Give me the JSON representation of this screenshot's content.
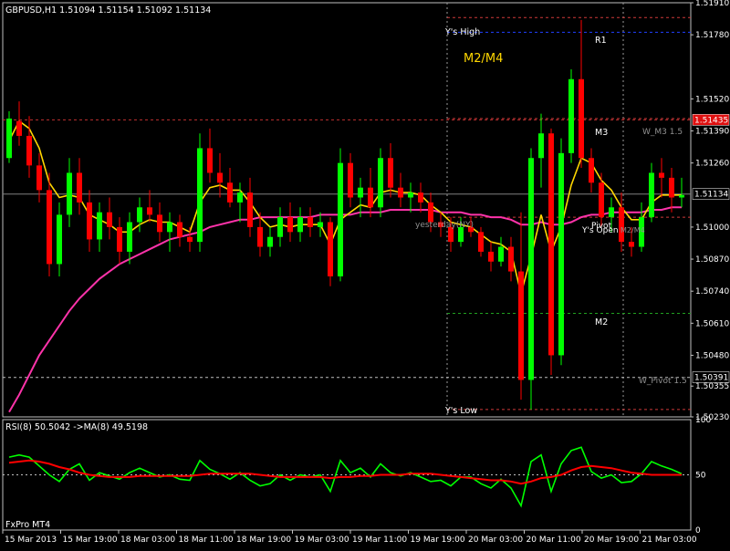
{
  "header": {
    "symbol_info": "GBPUSD,H1  1.51094 1.51154 1.51092 1.51134"
  },
  "footer": {
    "broker": "FxPro MT4"
  },
  "chart_data": [
    {
      "type": "candlestick",
      "ylim": [
        1.5023,
        1.5191
      ],
      "y_ticks": [
        "1.51910",
        "1.51780",
        "1.51520",
        "1.51390",
        "1.51260",
        "1.51000",
        "1.50870",
        "1.50740",
        "1.50610",
        "1.50480",
        "1.50355",
        "1.50230"
      ],
      "x_tick_labels": [
        "15 Mar 2013",
        "15 Mar 19:00",
        "18 Mar 03:00",
        "18 Mar 11:00",
        "18 Mar 19:00",
        "19 Mar 03:00",
        "19 Mar 11:00",
        "19 Mar 19:00",
        "20 Mar 03:00",
        "20 Mar 11:00",
        "20 Mar 19:00",
        "21 Mar 03:00"
      ],
      "price_tags": [
        {
          "value": "1.51435",
          "level": 1.51435,
          "color": "#e01010",
          "text_color": "#ffffff"
        },
        {
          "value": "1.51134",
          "level": 1.51134,
          "color": "#000000",
          "text_color": "#ffffff"
        },
        {
          "value": "1.50391",
          "level": 1.50391,
          "color": "#000000",
          "text_color": "#ffffff"
        }
      ],
      "levels": [
        {
          "label": "Y's High",
          "level": 1.5185,
          "color": "#d03a3a",
          "style": "dashed"
        },
        {
          "label": "R1",
          "level": 1.5179,
          "color": "#2040ff",
          "style": "dashed"
        },
        {
          "label": "M3",
          "level": 1.5144,
          "color": "#d03a3a",
          "style": "dashed"
        },
        {
          "label": "Pivot",
          "level": 1.5104,
          "color": "#d03a3a",
          "style": "dashed"
        },
        {
          "label": "M2",
          "level": 1.5065,
          "color": "#20a020",
          "style": "dashed"
        },
        {
          "label": "W_Pivot",
          "level": 1.5039,
          "color": "#c0c0c0",
          "style": "dashed"
        },
        {
          "label": "Y's Low",
          "level": 1.5026,
          "color": "#d03a3a",
          "style": "dashed"
        }
      ],
      "annotations": [
        {
          "text": "Y's High",
          "color": "#ffffff"
        },
        {
          "text": "M2/M4",
          "color": "#ffd700"
        },
        {
          "text": "R1",
          "color": "#ffffff"
        },
        {
          "text": "M3",
          "color": "#ffffff"
        },
        {
          "text": "W_M3 1.5",
          "color": "#909090"
        },
        {
          "text": "yesterday(NY)",
          "color": "#909090"
        },
        {
          "text": "Pivot",
          "color": "#ffffff"
        },
        {
          "text": "Y's Open",
          "color": "#ffffff"
        },
        {
          "text": "M2/M4",
          "color": "#909090"
        },
        {
          "text": "M2",
          "color": "#ffffff"
        },
        {
          "text": "W_Pivot 1.5",
          "color": "#909090"
        },
        {
          "text": "Y's Low",
          "color": "#ffffff"
        }
      ],
      "colors": {
        "bull": "#00ff00",
        "bear": "#ff0000",
        "ma_fast": "#ffd700",
        "ma_slow": "#ff33aa"
      },
      "series": [
        {
          "name": "candles",
          "candles": [
            [
              1.5128,
              1.5147,
              1.5126,
              1.5144
            ],
            [
              1.5143,
              1.5151,
              1.5133,
              1.5137
            ],
            [
              1.5137,
              1.5145,
              1.512,
              1.5125
            ],
            [
              1.5125,
              1.513,
              1.511,
              1.5115
            ],
            [
              1.5115,
              1.5122,
              1.508,
              1.5085
            ],
            [
              1.5085,
              1.511,
              1.508,
              1.5105
            ],
            [
              1.5105,
              1.5128,
              1.51,
              1.5122
            ],
            [
              1.5122,
              1.5128,
              1.5105,
              1.511
            ],
            [
              1.511,
              1.5115,
              1.509,
              1.5095
            ],
            [
              1.5095,
              1.511,
              1.509,
              1.5106
            ],
            [
              1.5106,
              1.5112,
              1.5095,
              1.51
            ],
            [
              1.51,
              1.5104,
              1.5085,
              1.509
            ],
            [
              1.509,
              1.5106,
              1.5085,
              1.5102
            ],
            [
              1.5102,
              1.5112,
              1.5098,
              1.5108
            ],
            [
              1.5108,
              1.5115,
              1.5102,
              1.5105
            ],
            [
              1.5105,
              1.511,
              1.5094,
              1.5098
            ],
            [
              1.5098,
              1.5106,
              1.509,
              1.5102
            ],
            [
              1.5102,
              1.5105,
              1.5092,
              1.5096
            ],
            [
              1.5096,
              1.51,
              1.509,
              1.5094
            ],
            [
              1.5094,
              1.5138,
              1.509,
              1.5132
            ],
            [
              1.5132,
              1.514,
              1.5118,
              1.5122
            ],
            [
              1.5122,
              1.513,
              1.5112,
              1.5118
            ],
            [
              1.5118,
              1.5124,
              1.5108,
              1.511
            ],
            [
              1.511,
              1.5118,
              1.5102,
              1.5114
            ],
            [
              1.5114,
              1.512,
              1.5096,
              1.51
            ],
            [
              1.51,
              1.5106,
              1.5088,
              1.5092
            ],
            [
              1.5092,
              1.51,
              1.5088,
              1.5096
            ],
            [
              1.5096,
              1.5108,
              1.5092,
              1.5104
            ],
            [
              1.5104,
              1.511,
              1.5094,
              1.5098
            ],
            [
              1.5098,
              1.5108,
              1.5094,
              1.5104
            ],
            [
              1.5104,
              1.5108,
              1.5096,
              1.51
            ],
            [
              1.51,
              1.5106,
              1.5096,
              1.5102
            ],
            [
              1.5102,
              1.5104,
              1.5076,
              1.508
            ],
            [
              1.508,
              1.5132,
              1.5078,
              1.5126
            ],
            [
              1.5126,
              1.513,
              1.5108,
              1.5112
            ],
            [
              1.5112,
              1.512,
              1.5104,
              1.5116
            ],
            [
              1.5116,
              1.5124,
              1.5104,
              1.5108
            ],
            [
              1.5108,
              1.5132,
              1.5104,
              1.5128
            ],
            [
              1.5128,
              1.5134,
              1.5112,
              1.5116
            ],
            [
              1.5116,
              1.5122,
              1.5108,
              1.5112
            ],
            [
              1.5112,
              1.5118,
              1.5106,
              1.5114
            ],
            [
              1.5114,
              1.5118,
              1.5106,
              1.511
            ],
            [
              1.511,
              1.5114,
              1.5098,
              1.5102
            ],
            [
              1.5102,
              1.5106,
              1.5096,
              1.51
            ],
            [
              1.51,
              1.5104,
              1.509,
              1.5094
            ],
            [
              1.5094,
              1.5104,
              1.5092,
              1.51
            ],
            [
              1.51,
              1.5104,
              1.5096,
              1.5098
            ],
            [
              1.5098,
              1.51,
              1.5088,
              1.509
            ],
            [
              1.509,
              1.5094,
              1.5082,
              1.5086
            ],
            [
              1.5086,
              1.5096,
              1.5084,
              1.5092
            ],
            [
              1.5092,
              1.5096,
              1.5078,
              1.5082
            ],
            [
              1.5082,
              1.5106,
              1.503,
              1.5038
            ],
            [
              1.5038,
              1.5132,
              1.5026,
              1.5128
            ],
            [
              1.5128,
              1.5146,
              1.5116,
              1.5138
            ],
            [
              1.5138,
              1.514,
              1.504,
              1.5048
            ],
            [
              1.5048,
              1.5136,
              1.5044,
              1.513
            ],
            [
              1.513,
              1.5164,
              1.5126,
              1.516
            ],
            [
              1.516,
              1.5184,
              1.5124,
              1.5128
            ],
            [
              1.5128,
              1.5132,
              1.5114,
              1.5118
            ],
            [
              1.5118,
              1.5122,
              1.51,
              1.5104
            ],
            [
              1.5104,
              1.5112,
              1.5098,
              1.5108
            ],
            [
              1.5108,
              1.5114,
              1.509,
              1.5094
            ],
            [
              1.5094,
              1.51,
              1.5088,
              1.5092
            ],
            [
              1.5092,
              1.511,
              1.509,
              1.5104
            ],
            [
              1.5104,
              1.5126,
              1.5102,
              1.5122
            ],
            [
              1.5122,
              1.5128,
              1.5112,
              1.512
            ],
            [
              1.512,
              1.5124,
              1.5106,
              1.5112
            ],
            [
              1.5112,
              1.512,
              1.5108,
              1.5113
            ]
          ]
        },
        {
          "name": "MA fast",
          "values": [
            1.5135,
            1.5143,
            1.514,
            1.5132,
            1.5118,
            1.5112,
            1.5113,
            1.5112,
            1.5105,
            1.5103,
            1.5101,
            1.5098,
            1.5098,
            1.5101,
            1.5103,
            1.5102,
            1.5102,
            1.51,
            1.5098,
            1.511,
            1.5116,
            1.5117,
            1.5115,
            1.5115,
            1.511,
            1.5104,
            1.51,
            1.5101,
            1.51,
            1.5101,
            1.5101,
            1.5101,
            1.5093,
            1.5103,
            1.5106,
            1.5109,
            1.5108,
            1.5114,
            1.5115,
            1.5114,
            1.5114,
            1.5113,
            1.5109,
            1.5106,
            1.5102,
            1.5101,
            1.51,
            1.5097,
            1.5094,
            1.5093,
            1.509,
            1.5073,
            1.5088,
            1.5105,
            1.509,
            1.51,
            1.5117,
            1.5128,
            1.5126,
            1.5119,
            1.5115,
            1.5108,
            1.5103,
            1.5103,
            1.511,
            1.5113,
            1.5113,
            1.5113
          ]
        },
        {
          "name": "MA slow",
          "values": [
            1.5025,
            1.5032,
            1.504,
            1.5048,
            1.5054,
            1.506,
            1.5066,
            1.5071,
            1.5075,
            1.5079,
            1.5082,
            1.5085,
            1.5087,
            1.5089,
            1.5091,
            1.5093,
            1.5095,
            1.5096,
            1.5097,
            1.5098,
            1.51,
            1.5101,
            1.5102,
            1.5103,
            1.5103,
            1.5104,
            1.5104,
            1.5104,
            1.5104,
            1.5104,
            1.5104,
            1.5105,
            1.5105,
            1.5105,
            1.5105,
            1.5106,
            1.5106,
            1.5106,
            1.5107,
            1.5107,
            1.5107,
            1.5107,
            1.5107,
            1.5106,
            1.5106,
            1.5106,
            1.5105,
            1.5105,
            1.5104,
            1.5104,
            1.5103,
            1.5101,
            1.5101,
            1.5102,
            1.5101,
            1.5101,
            1.5102,
            1.5104,
            1.5105,
            1.5105,
            1.5106,
            1.5106,
            1.5106,
            1.5106,
            1.5107,
            1.5107,
            1.5108,
            1.5108
          ]
        }
      ]
    },
    {
      "type": "line",
      "title": "RSI(8) 50.5042  ->MA(8) 49.5198",
      "ylim": [
        0,
        100
      ],
      "y_ticks": [
        "100",
        "50",
        "0"
      ],
      "series": [
        {
          "name": "RSI(8)",
          "color": "#00ff00",
          "values": [
            66,
            68,
            66,
            58,
            50,
            44,
            55,
            60,
            45,
            52,
            49,
            46,
            52,
            56,
            52,
            48,
            50,
            46,
            45,
            63,
            55,
            51,
            46,
            52,
            45,
            40,
            42,
            50,
            45,
            50,
            48,
            50,
            35,
            63,
            52,
            56,
            48,
            60,
            52,
            49,
            52,
            48,
            44,
            45,
            40,
            48,
            48,
            42,
            38,
            46,
            38,
            22,
            62,
            68,
            35,
            60,
            72,
            75,
            53,
            47,
            50,
            43,
            44,
            51,
            62,
            58,
            55,
            51
          ]
        },
        {
          "name": "MA(8)",
          "color": "#ff0000",
          "values": [
            61,
            62,
            63,
            62,
            60,
            57,
            55,
            52,
            50,
            49,
            48,
            48,
            48,
            49,
            49,
            49,
            49,
            49,
            49,
            50,
            51,
            51,
            51,
            51,
            51,
            50,
            49,
            48,
            48,
            48,
            48,
            48,
            47,
            48,
            48,
            49,
            49,
            50,
            50,
            50,
            51,
            51,
            51,
            50,
            49,
            48,
            47,
            46,
            45,
            45,
            44,
            42,
            44,
            47,
            48,
            50,
            54,
            57,
            58,
            57,
            56,
            54,
            52,
            51,
            50,
            50,
            50,
            50
          ]
        }
      ]
    }
  ]
}
